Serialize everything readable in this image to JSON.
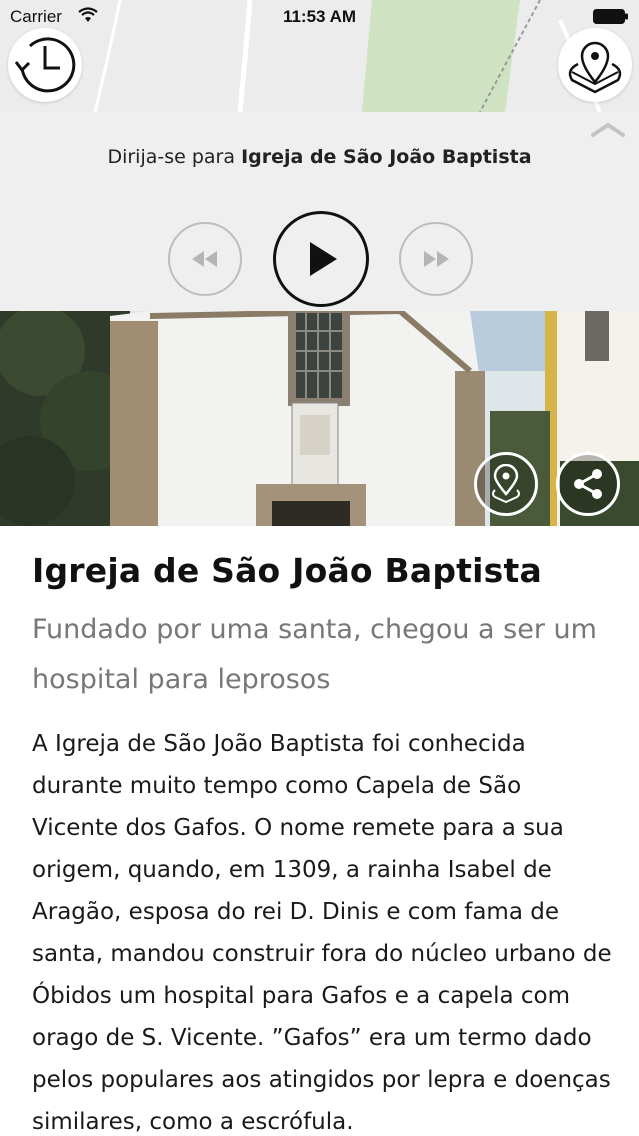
{
  "status_bar": {
    "carrier": "Carrier",
    "time": "11:53 AM"
  },
  "player": {
    "directions_prefix": "Dirija-se para ",
    "destination": "Igreja de São João Baptista"
  },
  "article": {
    "title": "Igreja de São João Baptista",
    "subtitle": "Fundado por uma santa, chegou a ser um hospital para leprosos",
    "body": "A Igreja de São João Baptista foi conhecida durante muito tempo como Capela de São Vicente dos Gafos. O nome remete para a sua origem, quando, em 1309, a rainha Isabel de Aragão, esposa do rei D. Dinis e com fama de santa, mandou construir fora do núcleo urbano de Óbidos um hospital para Gafos e a capela com orago de S. Vicente. ”Gafos” era um termo dado pelos populares aos atingidos por lepra e doenças similares, como a escrófula."
  },
  "icons": {
    "history": "history-clock-icon",
    "map_pins": "map-pins-icon",
    "collapse": "chevron-up-icon",
    "rewind": "rewind-icon",
    "play": "play-icon",
    "fast_forward": "fast-forward-icon",
    "locate": "map-pin-icon",
    "share": "share-icon"
  },
  "colors": {
    "map_green": "#cfe3c2",
    "panel": "#efefef",
    "subtitle": "#777777"
  }
}
